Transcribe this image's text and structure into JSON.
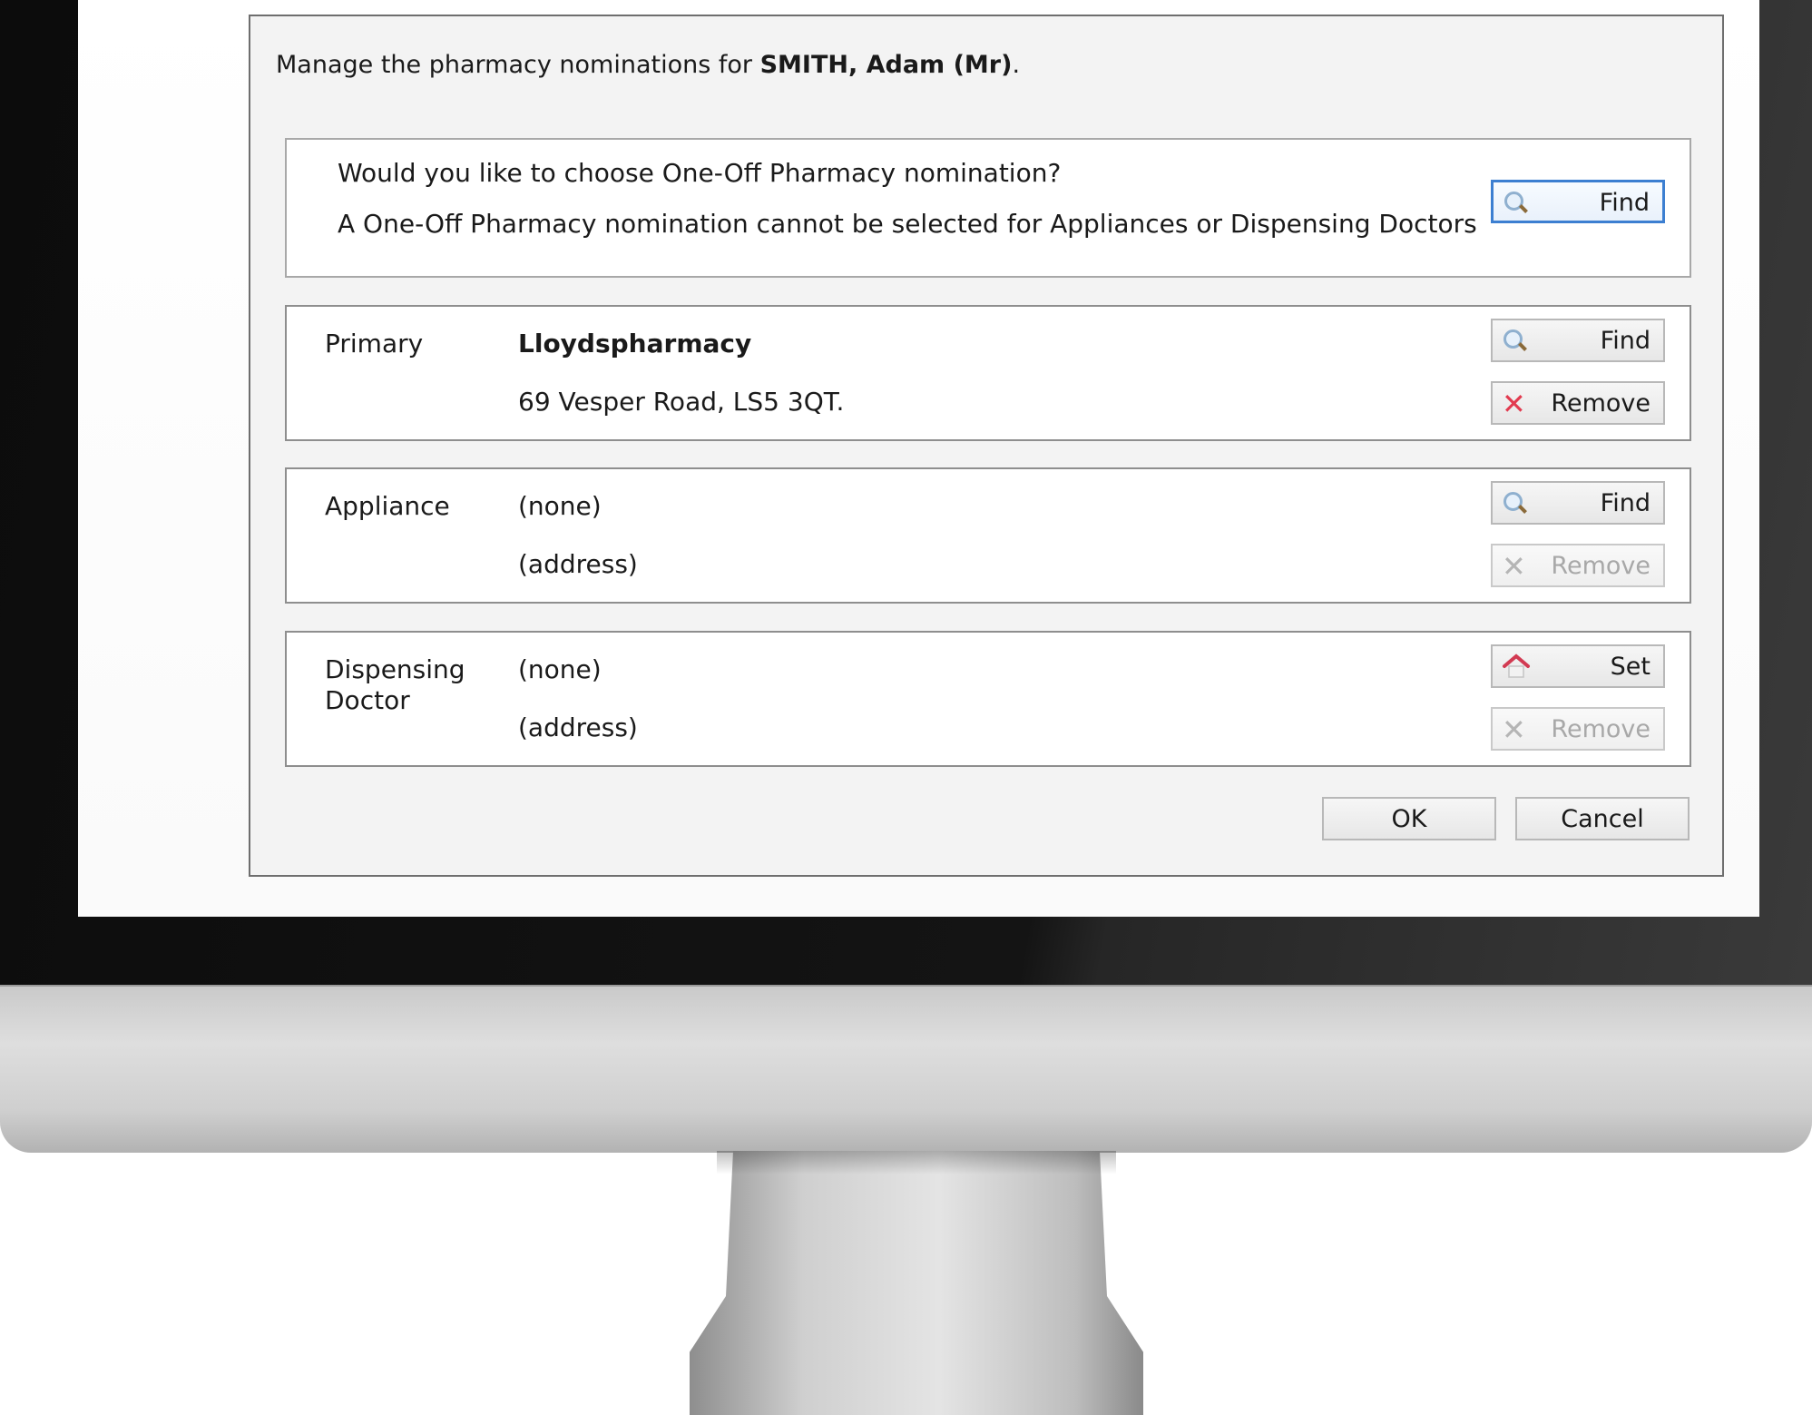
{
  "dialog": {
    "intro_prefix": "Manage the pharmacy nominations for ",
    "patient_name": "SMITH, Adam (Mr)",
    "intro_suffix": "."
  },
  "one_off": {
    "question": "Would you like to choose One-Off Pharmacy nomination?",
    "note": "A One-Off Pharmacy nomination cannot be selected for Appliances or Dispensing Doctors",
    "find_label": "Find"
  },
  "primary": {
    "label": "Primary",
    "name": "Lloydspharmacy",
    "address": "69 Vesper Road, LS5 3QT.",
    "find_label": "Find",
    "remove_label": "Remove"
  },
  "appliance": {
    "label": "Appliance",
    "name": "(none)",
    "address": "(address)",
    "find_label": "Find",
    "remove_label": "Remove"
  },
  "dispensing": {
    "label": "Dispensing Doctor",
    "name": "(none)",
    "address": "(address)",
    "set_label": "Set",
    "remove_label": "Remove"
  },
  "footer": {
    "ok_label": "OK",
    "cancel_label": "Cancel"
  },
  "icons": {
    "find": "magnifier-icon",
    "remove": "red-x-icon",
    "set": "house-icon"
  },
  "colors": {
    "focus_border": "#3c7fd1",
    "remove_icon": "#e23a4f"
  }
}
